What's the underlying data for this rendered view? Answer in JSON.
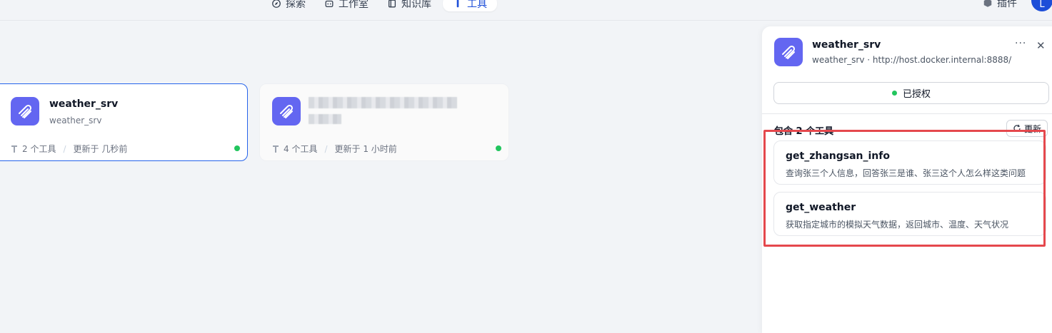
{
  "topbar": {
    "nav": [
      {
        "label": "探索",
        "icon": "compass-icon"
      },
      {
        "label": "工作室",
        "icon": "robot-icon"
      },
      {
        "label": "知识库",
        "icon": "book-icon"
      },
      {
        "label": "工具",
        "icon": "tool-icon",
        "active": true
      }
    ],
    "plugin_label": "插件",
    "avatar_initial": "L"
  },
  "cards": [
    {
      "title": "weather_srv",
      "subtitle": "weather_srv",
      "tools": "2 个工具",
      "updated": "更新于 几秒前",
      "status_color": "#22c55e",
      "selected": true
    },
    {
      "title": "",
      "subtitle": "",
      "tools": "4 个工具",
      "updated": "更新于 1 小时前",
      "status_color": "#22c55e",
      "selected": false
    }
  ],
  "panel": {
    "title": "weather_srv",
    "subtitle": "weather_srv · http://host.docker.internal:8888/...",
    "more": "···",
    "close": "✕",
    "auth_label": "已授权",
    "tools_count": "包含 2 个工具",
    "refresh_label": "更新",
    "tools": [
      {
        "name": "get_zhangsan_info",
        "desc": "查询张三个人信息，回答张三是谁、张三这个人怎么样这类问题"
      },
      {
        "name": "get_weather",
        "desc": "获取指定城市的模拟天气数据，返回城市、温度、天气状况"
      }
    ]
  },
  "colors": {
    "accent": "#1d4ed8",
    "icon_bg": "#6366f1",
    "status": "#22c55e",
    "highlight": "#e5484d"
  }
}
